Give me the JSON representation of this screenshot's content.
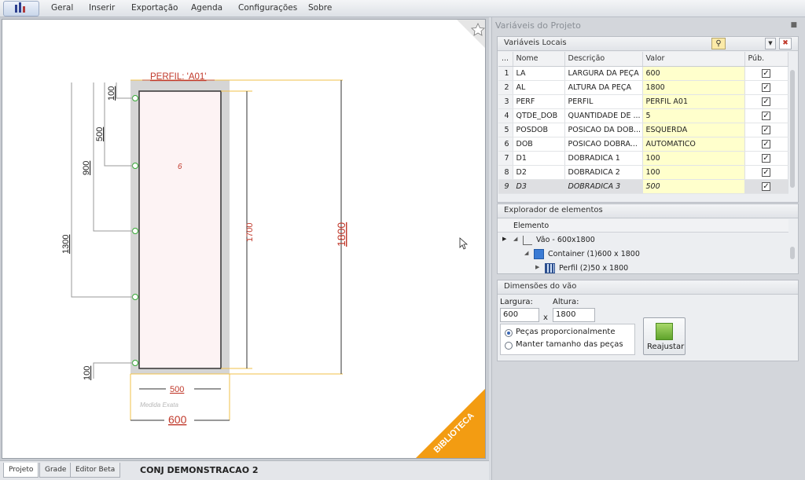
{
  "menu": [
    "Geral",
    "Inserir",
    "Exportação",
    "Agenda",
    "Configurações",
    "Sobre"
  ],
  "drawing": {
    "profile_label": "PERFIL: 'A01'",
    "piece_number": "6",
    "dim_100_top": "100",
    "dim_500_left": "500",
    "dim_900": "900",
    "dim_1300": "1300",
    "dim_100_bottom": "100",
    "dim_1700": "1700",
    "dim_1800": "1800",
    "dim_500_bottom": "500",
    "exact_measure": "Medida Exata",
    "dim_600": "600",
    "ribbon": "BIBLIOTECA"
  },
  "bottom_tabs": [
    "Projeto",
    "Grade",
    "Editor Beta"
  ],
  "project_name": "CONJ DEMONSTRACAO 2",
  "panel": {
    "title": "Variáveis do Projeto",
    "local_vars_title": "Variáveis Locais",
    "columns": [
      "...",
      "Nome",
      "Descrição",
      "Valor",
      "Púb."
    ],
    "rows": [
      {
        "n": "1",
        "nome": "LA",
        "desc": "LARGURA DA PEÇA",
        "valor": "600",
        "pub": true
      },
      {
        "n": "2",
        "nome": "AL",
        "desc": "ALTURA DA PEÇA",
        "valor": "1800",
        "pub": true
      },
      {
        "n": "3",
        "nome": "PERF",
        "desc": "PERFIL",
        "valor": "PERFIL A01",
        "pub": true
      },
      {
        "n": "4",
        "nome": "QTDE_DOB",
        "desc": "QUANTIDADE DE ...",
        "valor": "5",
        "pub": true
      },
      {
        "n": "5",
        "nome": "POSDOB",
        "desc": "POSICAO DA DOB...",
        "valor": "ESQUERDA",
        "pub": true
      },
      {
        "n": "6",
        "nome": "DOB",
        "desc": "POSICAO DOBRA...",
        "valor": "AUTOMATICO",
        "pub": true
      },
      {
        "n": "7",
        "nome": "D1",
        "desc": "DOBRADICA 1",
        "valor": "100",
        "pub": true
      },
      {
        "n": "8",
        "nome": "D2",
        "desc": "DOBRADICA 2",
        "valor": "100",
        "pub": true
      },
      {
        "n": "9",
        "nome": "D3",
        "desc": "DOBRADICA 3",
        "valor": "500",
        "pub": true
      }
    ],
    "explorer_title": "Explorador de elementos",
    "explorer_column": "Elemento",
    "tree": [
      "Vão - 600x1800",
      "Container (1)600 x 1800",
      "Perfil (2)50 x 1800"
    ],
    "dims_title": "Dimensões do vão",
    "width_label": "Largura:",
    "height_label": "Altura:",
    "width_value": "600",
    "height_value": "1800",
    "times": "x",
    "radio1": "Peças proporcionalmente",
    "radio2": "Manter tamanho das peças",
    "readjust_label": "Reajustar"
  }
}
